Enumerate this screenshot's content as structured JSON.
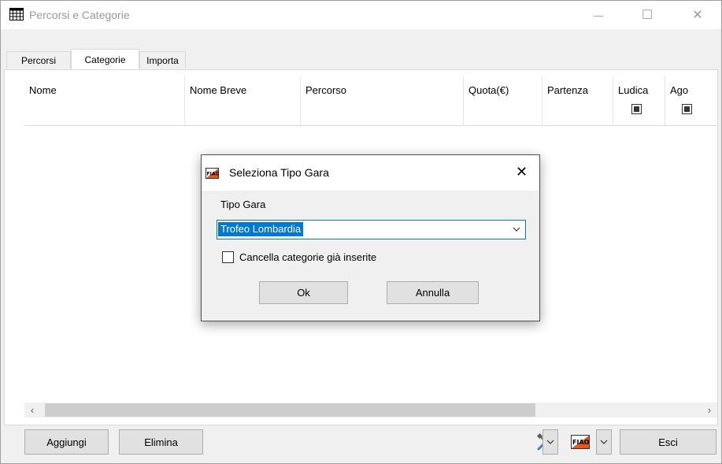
{
  "window": {
    "title": "Percorsi e Categorie",
    "controls": {
      "minimize": "—",
      "maximize": "☐",
      "close": "✕"
    }
  },
  "tabs": [
    {
      "label": "Percorsi",
      "selected": false
    },
    {
      "label": "Categorie",
      "selected": true
    },
    {
      "label": "Importa",
      "selected": false
    }
  ],
  "grid": {
    "columns": [
      "Nome",
      "Nome Breve",
      "Percorso",
      "Quota(€)",
      "Partenza",
      "Ludica",
      "Ago"
    ]
  },
  "scrollbar": {
    "left_arrow": "‹",
    "right_arrow": "›"
  },
  "bottom": {
    "add_label": "Aggiungi",
    "delete_label": "Elimina",
    "exit_label": "Esci",
    "tools_icon": "tools-icon",
    "fiao_icon": "fiao-logo-icon"
  },
  "dialog": {
    "title": "Seleziona Tipo Gara",
    "close": "✕",
    "field_label": "Tipo Gara",
    "combo_value": "Trofeo Lombardia",
    "checkbox_label": "Cancella categorie già inserite",
    "checkbox_checked": false,
    "ok_label": "Ok",
    "cancel_label": "Annulla"
  },
  "colors": {
    "accent": "#0078d7",
    "panel": "#f0f0f0",
    "button": "#e1e1e1"
  }
}
